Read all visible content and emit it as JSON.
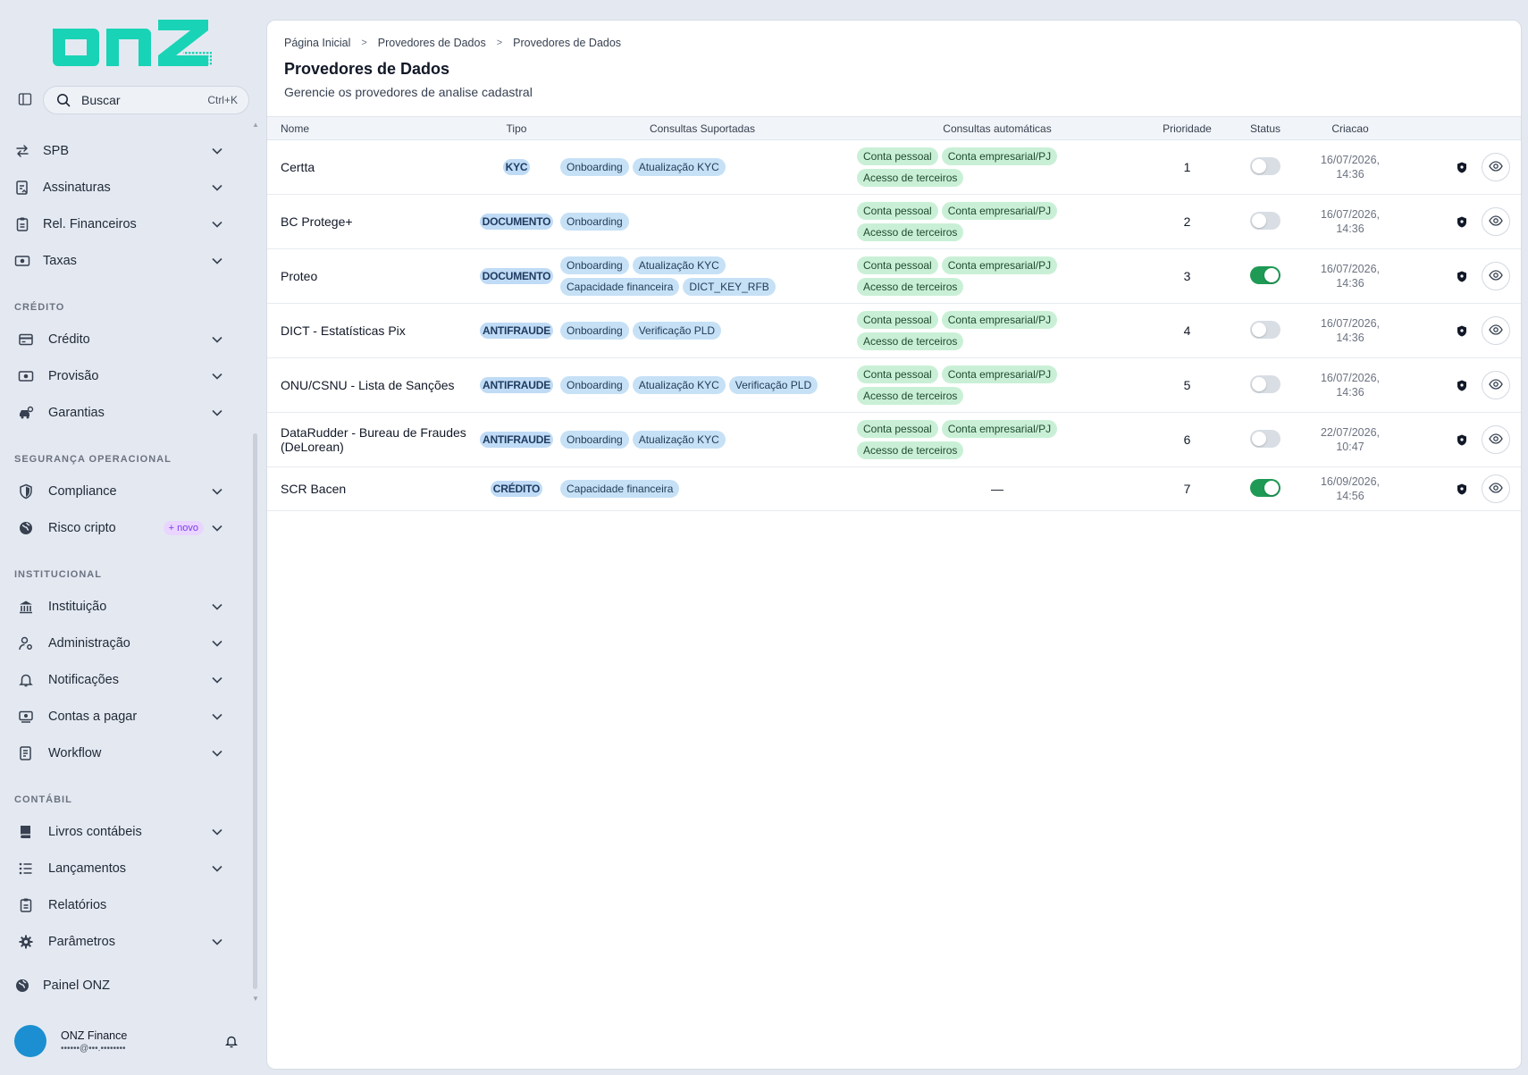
{
  "brand": {
    "logo_text": "onz",
    "color": "#19d3b6"
  },
  "search": {
    "label": "Buscar",
    "shortcut": "Ctrl+K"
  },
  "sidebar": {
    "top_items": [
      {
        "label": "SPB",
        "icon": "arrows-swap-icon"
      },
      {
        "label": "Assinaturas",
        "icon": "signature-icon"
      },
      {
        "label": "Rel. Financeiros",
        "icon": "clipboard-icon"
      },
      {
        "label": "Taxas",
        "icon": "money-icon"
      }
    ],
    "sections": [
      {
        "title": "CRÉDITO",
        "items": [
          {
            "label": "Crédito",
            "icon": "card-icon"
          },
          {
            "label": "Provisão",
            "icon": "money-icon"
          },
          {
            "label": "Garantias",
            "icon": "car-icon"
          }
        ]
      },
      {
        "title": "SEGURANÇA OPERACIONAL",
        "items": [
          {
            "label": "Compliance",
            "icon": "shield-icon"
          },
          {
            "label": "Risco cripto",
            "icon": "globe-icon",
            "badge": "+ novo"
          }
        ]
      },
      {
        "title": "INSTITUCIONAL",
        "items": [
          {
            "label": "Instituição",
            "icon": "bank-icon"
          },
          {
            "label": "Administração",
            "icon": "user-gear-icon"
          },
          {
            "label": "Notificações",
            "icon": "bell-icon"
          },
          {
            "label": "Contas a pagar",
            "icon": "bill-icon"
          },
          {
            "label": "Workflow",
            "icon": "document-icon"
          }
        ]
      },
      {
        "title": "CONTÁBIL",
        "items": [
          {
            "label": "Livros contábeis",
            "icon": "book-icon"
          },
          {
            "label": "Lançamentos",
            "icon": "list-icon"
          },
          {
            "label": "Relatórios",
            "icon": "clipboard-icon",
            "no_chevron": true
          },
          {
            "label": "Parâmetros",
            "icon": "gear-icon"
          }
        ]
      }
    ],
    "footer_item": {
      "label": "Painel ONZ",
      "icon": "globe-icon"
    }
  },
  "user": {
    "name": "ONZ Finance",
    "email": "••••••@•••.••••••••"
  },
  "breadcrumb": [
    "Página Inicial",
    "Provedores de Dados",
    "Provedores de Dados"
  ],
  "page": {
    "title": "Provedores de Dados",
    "subtitle": "Gerencie os provedores de analise cadastral"
  },
  "table": {
    "headers": {
      "name": "Nome",
      "type": "Tipo",
      "supported": "Consultas Suportadas",
      "automatic": "Consultas automáticas",
      "priority": "Prioridade",
      "status": "Status",
      "created": "Criacao"
    },
    "rows": [
      {
        "name": "Certta",
        "type": "KYC",
        "supported": [
          "Onboarding",
          "Atualização KYC"
        ],
        "automatic": [
          "Conta pessoal",
          "Conta empresarial/PJ",
          "Acesso de terceiros"
        ],
        "priority": "1",
        "status_on": false,
        "date": "16/07/2026,",
        "time": "14:36"
      },
      {
        "name": "BC Protege+",
        "type": "DOCUMENTO",
        "supported": [
          "Onboarding"
        ],
        "automatic": [
          "Conta pessoal",
          "Conta empresarial/PJ",
          "Acesso de terceiros"
        ],
        "priority": "2",
        "status_on": false,
        "date": "16/07/2026,",
        "time": "14:36"
      },
      {
        "name": "Proteo",
        "type": "DOCUMENTO",
        "supported": [
          "Onboarding",
          "Atualização KYC",
          "Capacidade financeira",
          "DICT_KEY_RFB"
        ],
        "automatic": [
          "Conta pessoal",
          "Conta empresarial/PJ",
          "Acesso de terceiros"
        ],
        "priority": "3",
        "status_on": true,
        "date": "16/07/2026,",
        "time": "14:36"
      },
      {
        "name": "DICT - Estatísticas Pix",
        "type": "ANTIFRAUDE",
        "supported": [
          "Onboarding",
          "Verificação PLD"
        ],
        "automatic": [
          "Conta pessoal",
          "Conta empresarial/PJ",
          "Acesso de terceiros"
        ],
        "priority": "4",
        "status_on": false,
        "date": "16/07/2026,",
        "time": "14:36"
      },
      {
        "name": "ONU/CSNU - Lista de Sanções",
        "type": "ANTIFRAUDE",
        "supported": [
          "Onboarding",
          "Atualização KYC",
          "Verificação PLD"
        ],
        "automatic": [
          "Conta pessoal",
          "Conta empresarial/PJ",
          "Acesso de terceiros"
        ],
        "priority": "5",
        "status_on": false,
        "date": "16/07/2026,",
        "time": "14:36"
      },
      {
        "name": "DataRudder - Bureau de Fraudes (DeLorean)",
        "type": "ANTIFRAUDE",
        "supported": [
          "Onboarding",
          "Atualização KYC"
        ],
        "automatic": [
          "Conta pessoal",
          "Conta empresarial/PJ",
          "Acesso de terceiros"
        ],
        "priority": "6",
        "status_on": false,
        "date": "22/07/2026,",
        "time": "10:47"
      },
      {
        "name": "SCR Bacen",
        "type": "CRÉDITO",
        "supported": [
          "Capacidade financeira"
        ],
        "automatic": [],
        "automatic_empty": "—",
        "priority": "7",
        "status_on": true,
        "date": "16/09/2026,",
        "time": "14:56"
      }
    ]
  },
  "colors": {
    "accent": "#19d3b6",
    "toggle_on": "#1f9a55",
    "chip_blue": "#c6e1f6",
    "chip_green": "#c9f0d6",
    "badge_purple": "#e9d5ff",
    "avatar": "#1b8fd1"
  }
}
